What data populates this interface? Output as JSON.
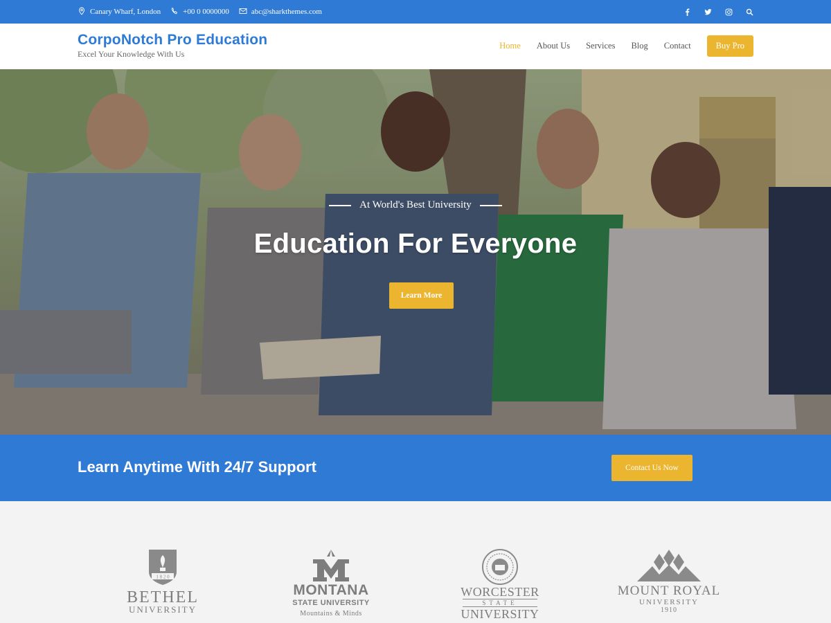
{
  "topbar": {
    "address": "Canary Wharf, London",
    "phone": "+00 0 0000000",
    "email": "abc@sharkthemes.com",
    "social": [
      "facebook-icon",
      "twitter-icon",
      "instagram-icon",
      "search-icon"
    ]
  },
  "header": {
    "brand_title": "CorpoNotch Pro Education",
    "brand_tagline": "Excel Your Knowledge With Us",
    "nav": [
      "Home",
      "About Us",
      "Services",
      "Blog",
      "Contact"
    ],
    "active_nav": "Home",
    "buy_label": "Buy Pro"
  },
  "hero": {
    "kicker": "At World's Best University",
    "title": "Education For Everyone",
    "button_label": "Learn More"
  },
  "cta": {
    "text": "Learn Anytime With 24/7 Support",
    "button_label": "Contact Us Now"
  },
  "logos": [
    {
      "name": "BETHEL",
      "sub": "UNIVERSITY",
      "year": "1 8 2 0"
    },
    {
      "name": "MONTANA",
      "sub": "STATE UNIVERSITY",
      "tag": "Mountains & Minds"
    },
    {
      "name": "WORCESTER",
      "mid": "STATE",
      "sub": "UNIVERSITY"
    },
    {
      "name": "MOUNT ROYAL",
      "sub": "UNIVERSITY",
      "year": "1910"
    }
  ],
  "colors": {
    "primary": "#2f7ad5",
    "accent": "#ebb52f",
    "logo_gray": "#7d7d7d"
  }
}
